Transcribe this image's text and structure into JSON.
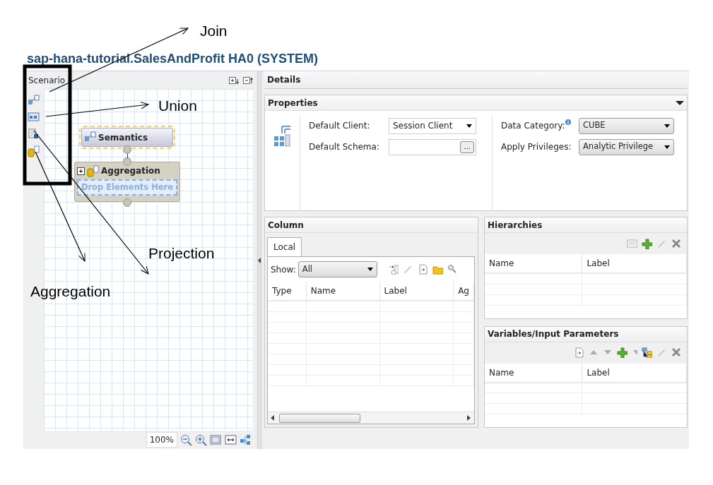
{
  "annotations": [
    {
      "kind": "join",
      "label": "Join"
    },
    {
      "kind": "union",
      "label": "Union"
    },
    {
      "kind": "projection",
      "label": "Projection"
    },
    {
      "kind": "aggregation",
      "label": "Aggregation"
    }
  ],
  "title": "sap-hana-tutorial.SalesAndProfit HA0 (SYSTEM)",
  "scenario": {
    "title": "Scenario"
  },
  "canvas": {
    "nodes": [
      {
        "kind": "semantics",
        "label": "Semantics",
        "selected": true
      },
      {
        "kind": "aggregation",
        "label": "Aggregation",
        "selected": false,
        "drop_hint": "Drop Elements Here"
      }
    ],
    "zoom": "100%"
  },
  "details": {
    "title": "Details",
    "properties": {
      "title": "Properties",
      "left_fields": [
        {
          "kind": "dropdown",
          "label": "Default Client:",
          "value": "Session Client"
        },
        {
          "kind": "browse",
          "label": "Default Schema:",
          "button": "..."
        }
      ],
      "right_fields": [
        {
          "kind": "dropdown",
          "label": "Data Category:",
          "info": true,
          "value": "CUBE"
        },
        {
          "kind": "dropdown",
          "label": "Apply Privileges:",
          "info": false,
          "value": "Analytic Privilege"
        }
      ]
    },
    "column": {
      "title": "Column",
      "tabs": [
        {
          "label": "Local",
          "selected": true
        }
      ],
      "show_label": "Show:",
      "show_value": "All",
      "columns": [
        "Type",
        "Name",
        "Label",
        "Ag"
      ]
    },
    "hierarchies": {
      "title": "Hierarchies",
      "columns": [
        "Name",
        "Label"
      ]
    },
    "variables": {
      "title": "Variables/Input Parameters",
      "columns": [
        "Name",
        "Label"
      ]
    }
  }
}
